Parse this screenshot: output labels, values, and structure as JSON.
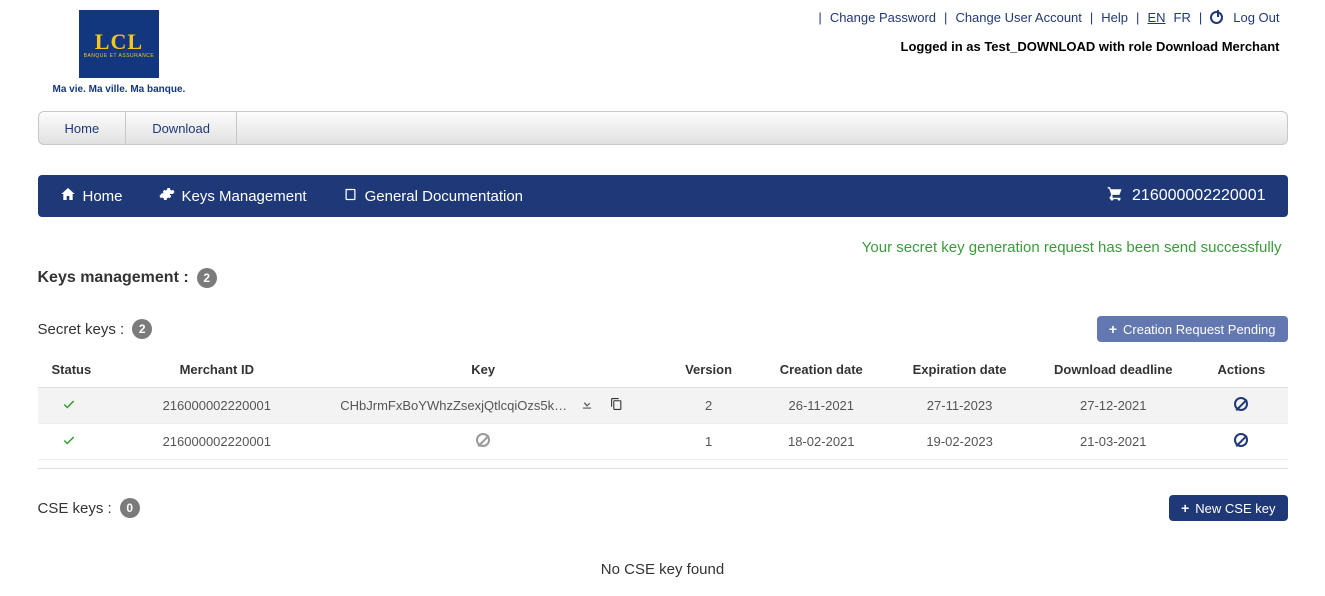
{
  "header": {
    "logo_text": "LCL",
    "logo_sub": "BANQUE ET ASSURANCE",
    "tagline": "Ma vie. Ma ville. Ma banque.",
    "links": {
      "change_password": "Change Password",
      "change_user": "Change User Account",
      "help": "Help",
      "lang_en": "EN",
      "lang_fr": "FR",
      "logout": "Log Out"
    },
    "logged_in": "Logged in as Test_DOWNLOAD with role Download Merchant"
  },
  "tabs": {
    "home": "Home",
    "download": "Download"
  },
  "nav": {
    "home": "Home",
    "keys": "Keys Management",
    "docs": "General Documentation",
    "merchant_id": "216000002220001"
  },
  "messages": {
    "success": "Your secret key generation request has been send successfully"
  },
  "sections": {
    "keys_mgmt_label": "Keys management :",
    "keys_mgmt_count": "2",
    "secret_keys_label": "Secret keys :",
    "secret_keys_count": "2",
    "creation_pending_btn": "Creation Request Pending",
    "cse_keys_label": "CSE keys :",
    "cse_keys_count": "0",
    "new_cse_btn": "New CSE key",
    "no_cse": "No CSE key found"
  },
  "table": {
    "headers": {
      "status": "Status",
      "merchant_id": "Merchant ID",
      "key": "Key",
      "version": "Version",
      "creation_date": "Creation date",
      "expiration_date": "Expiration date",
      "download_deadline": "Download deadline",
      "actions": "Actions"
    },
    "rows": [
      {
        "merchant_id": "216000002220001",
        "key": "CHbJrmFxBoYWhzZsexjQtlcqiOzs5k…",
        "version": "2",
        "creation_date": "26-11-2021",
        "expiration_date": "27-11-2023",
        "download_deadline": "27-12-2021",
        "has_key": true
      },
      {
        "merchant_id": "216000002220001",
        "key": "",
        "version": "1",
        "creation_date": "18-02-2021",
        "expiration_date": "19-02-2023",
        "download_deadline": "21-03-2021",
        "has_key": false
      }
    ]
  }
}
